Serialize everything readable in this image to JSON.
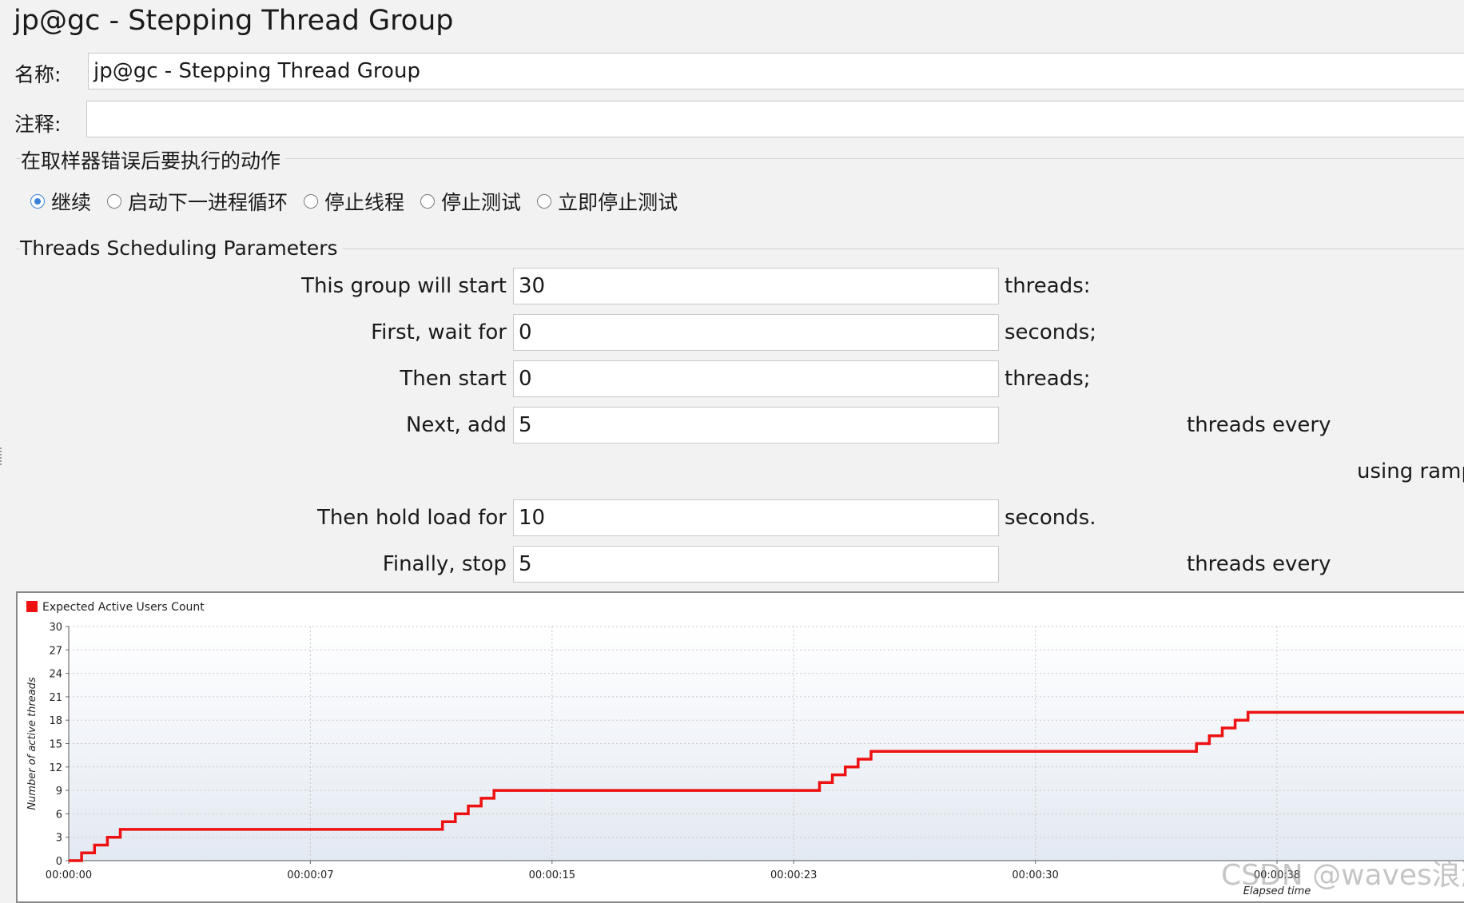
{
  "header": {
    "title": "jp@gc - Stepping Thread Group"
  },
  "name_row": {
    "label": "名称:",
    "value": "jp@gc - Stepping Thread Group"
  },
  "comment_row": {
    "label": "注释:",
    "value": ""
  },
  "error_action": {
    "title": "在取样器错误后要执行的动作",
    "options": [
      {
        "label": "继续",
        "selected": true
      },
      {
        "label": "启动下一进程循环",
        "selected": false
      },
      {
        "label": "停止线程",
        "selected": false
      },
      {
        "label": "停止测试",
        "selected": false
      },
      {
        "label": "立即停止测试",
        "selected": false
      }
    ]
  },
  "scheduling": {
    "title": "Threads Scheduling Parameters",
    "start_threads": {
      "label": "This group will start",
      "value": "30",
      "unit": "threads:"
    },
    "initial_delay": {
      "label": "First, wait for",
      "value": "0",
      "unit": "seconds;"
    },
    "start_users": {
      "label": "Then start",
      "value": "0",
      "unit": "threads;"
    },
    "next_add": {
      "label": "Next, add",
      "value": "5",
      "unit": "threads every"
    },
    "ramp_note": "using ramp",
    "hold": {
      "label": "Then hold load for",
      "value": "10",
      "unit": "seconds."
    },
    "stop": {
      "label": "Finally, stop",
      "value": "5",
      "unit": "threads every"
    }
  },
  "chart_data": {
    "type": "line",
    "title": "",
    "legend": "Expected Active Users Count",
    "legend_position": "top-left",
    "color": "#ee1111",
    "xlabel": "Elapsed time",
    "ylabel": "Number of active threads",
    "ylim": [
      0,
      30
    ],
    "xlim": [
      0,
      43.7
    ],
    "yticks": [
      "0",
      "3",
      "6",
      "9",
      "12",
      "15",
      "18",
      "21",
      "24",
      "27",
      "30"
    ],
    "xticks": [
      {
        "t": 0,
        "label": "00:00:00"
      },
      {
        "t": 7.5,
        "label": "00:00:07"
      },
      {
        "t": 15,
        "label": "00:00:15"
      },
      {
        "t": 22.5,
        "label": "00:00:23"
      },
      {
        "t": 30,
        "label": "00:00:30"
      },
      {
        "t": 37.5,
        "label": "00:00:38"
      }
    ],
    "grid": true,
    "series": [
      {
        "name": "Expected Active Users Count",
        "x": [
          0,
          0.4,
          0.4,
          0.8,
          0.8,
          1.2,
          1.2,
          1.6,
          1.6,
          11.6,
          11.6,
          12.0,
          12.0,
          12.4,
          12.4,
          12.8,
          12.8,
          13.2,
          13.2,
          23.3,
          23.3,
          23.7,
          23.7,
          24.1,
          24.1,
          24.5,
          24.5,
          24.9,
          24.9,
          35.0,
          35.0,
          35.4,
          35.4,
          35.8,
          35.8,
          36.2,
          36.2,
          36.6,
          36.6,
          43.7
        ],
        "y": [
          0,
          0,
          1,
          1,
          2,
          2,
          3,
          3,
          4,
          4,
          5,
          5,
          6,
          6,
          7,
          7,
          8,
          8,
          9,
          9,
          10,
          10,
          11,
          11,
          12,
          12,
          13,
          13,
          14,
          14,
          15,
          15,
          16,
          16,
          17,
          17,
          18,
          18,
          19,
          19
        ]
      }
    ]
  },
  "watermark": "CSDN @waves浪游"
}
